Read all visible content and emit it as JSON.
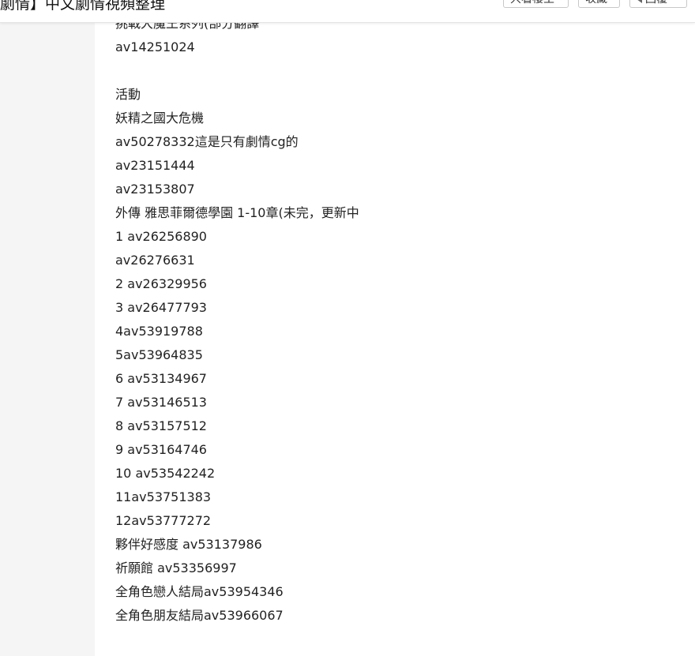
{
  "header": {
    "title": "劇情】中文劇情視頻整理",
    "buttons": [
      {
        "label": "只看樓主"
      },
      {
        "label": "收藏"
      },
      {
        "label": "回覆",
        "icon": "back-arrow-icon"
      }
    ]
  },
  "post": {
    "lines": [
      "挑戰大魔王系列(部分翻譯",
      "av14251024",
      "",
      "活動",
      "妖精之國大危機",
      "av50278332這是只有劇情cg的",
      "av23151444",
      "av23153807",
      "外傳 雅思菲爾德學園 1-10章(未完，更新中",
      "1 av26256890",
      "av26276631",
      "2 av26329956",
      "3 av26477793",
      "4av53919788",
      "5av53964835",
      "6 av53134967",
      "7 av53146513",
      "8 av53157512",
      "9 av53164746",
      "10 av53542242",
      "11av53751383",
      "12av53777272",
      "夥伴好感度 av53137986",
      "祈願館 av53356997",
      "全角色戀人結局av53954346",
      "全角色朋友結局av53966067"
    ]
  }
}
